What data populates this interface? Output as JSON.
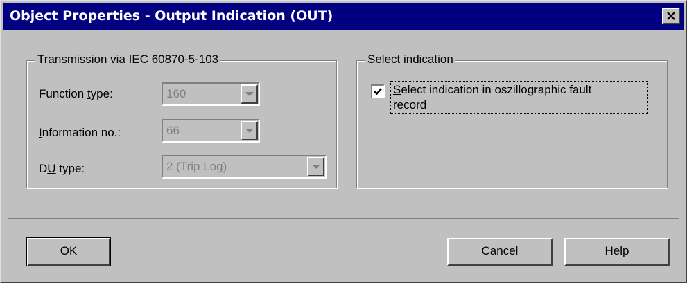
{
  "window": {
    "title": "Object Properties - Output Indication (OUT)",
    "close_glyph": "✕"
  },
  "transmission_group": {
    "title": "Transmission via IEC 60870-5-103",
    "function_type": {
      "label_pre": "Function ",
      "label_ul": "t",
      "label_post": "ype:",
      "value": "160"
    },
    "information_no": {
      "label_pre": "",
      "label_ul": "I",
      "label_post": "nformation no.:",
      "value": "66"
    },
    "du_type": {
      "label_pre": "D",
      "label_ul": "U",
      "label_post": " type:",
      "value": "2 (Trip Log)"
    }
  },
  "select_group": {
    "title": "Select indication",
    "checkbox": {
      "checked": true,
      "label_ul": "S",
      "label_rest_line1": "elect indication in oszillographic fault",
      "label_line2": "record"
    }
  },
  "buttons": {
    "ok": "OK",
    "cancel": "Cancel",
    "help": "Help"
  },
  "icons": {
    "close": "close-icon",
    "dropdown": "chevron-down-icon",
    "check": "check-icon"
  }
}
